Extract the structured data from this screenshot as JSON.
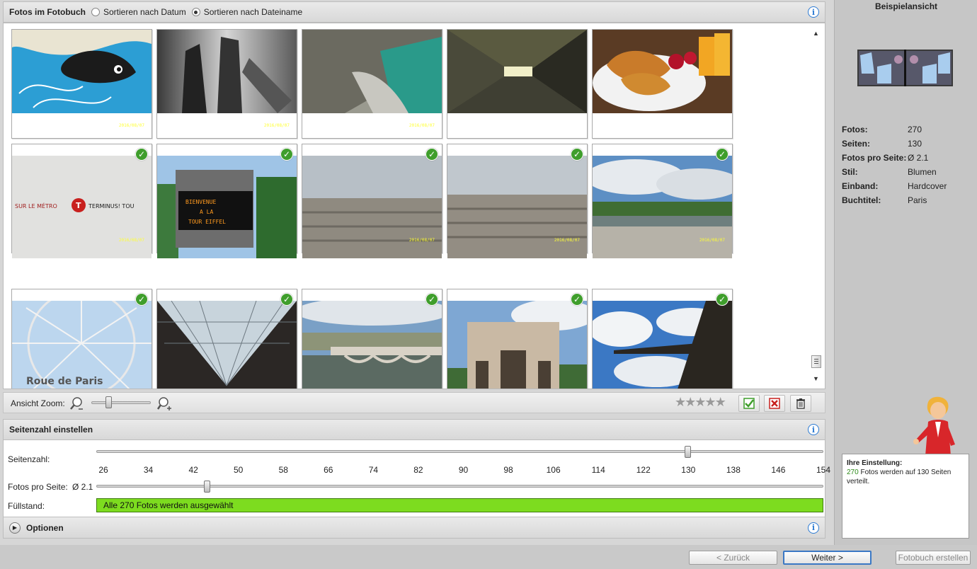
{
  "photos_header": {
    "title": "Fotos im Fotobuch",
    "sort_date": "Sortieren nach Datum",
    "sort_filename": "Sortieren nach Dateiname",
    "selected_sort": "filename"
  },
  "photos": [
    {
      "date": "2016/08/07",
      "checked": false
    },
    {
      "date": "2016/08/07",
      "checked": false
    },
    {
      "date": "2016/08/07",
      "checked": false
    },
    {
      "date": "",
      "checked": false
    },
    {
      "date": "",
      "checked": false
    },
    {
      "date": "2016/08/07",
      "checked": true
    },
    {
      "date": "",
      "checked": true
    },
    {
      "date": "2016/08/07",
      "checked": true
    },
    {
      "date": "2016/08/07",
      "checked": true
    },
    {
      "date": "2016/08/07",
      "checked": true
    },
    {
      "date": "",
      "checked": true
    },
    {
      "date": "",
      "checked": true
    },
    {
      "date": "",
      "checked": true
    },
    {
      "date": "",
      "checked": true
    },
    {
      "date": "",
      "checked": true
    }
  ],
  "zoom": {
    "label": "Ansicht Zoom:",
    "level": 0.3
  },
  "rating_stars": 5,
  "pages_panel": {
    "title": "Seitenzahl einstellen",
    "pages_label": "Seitenzahl:",
    "ticks": [
      "26",
      "34",
      "42",
      "50",
      "58",
      "66",
      "74",
      "82",
      "90",
      "98",
      "106",
      "114",
      "122",
      "130",
      "138",
      "146",
      "154"
    ],
    "pages_value": 130,
    "pages_min": 26,
    "pages_max": 154,
    "fotos_pro_seite_label": "Fotos pro Seite:",
    "fotos_pro_seite_value": "Ø 2.1",
    "fotos_pro_seite_level": 0.145,
    "fill_label": "Füllstand:",
    "fill_text": "Alle 270 Fotos werden ausgewählt",
    "fill_level": 1.0,
    "options_label": "Optionen"
  },
  "preview": {
    "title": "Beispielansicht"
  },
  "stats": [
    {
      "label": "Fotos:",
      "value": "270"
    },
    {
      "label": "Seiten:",
      "value": "130"
    },
    {
      "label": "Fotos pro Seite:",
      "value": "Ø 2.1"
    },
    {
      "label": "Stil:",
      "value": "Blumen"
    },
    {
      "label": "Einband:",
      "value": "Hardcover"
    },
    {
      "label": "Buchtitel:",
      "value": "Paris"
    }
  ],
  "hint": {
    "title": "Ihre Einstellung:",
    "count": "270",
    "text": "Fotos werden auf 130 Seiten verteilt."
  },
  "nav": {
    "back": "< Zurück",
    "next": "Weiter >",
    "create": "Fotobuch erstellen"
  },
  "colors": {
    "accent": "#2d7bd3",
    "check_green": "#3f9e2c",
    "fill_green": "#7ddc1f",
    "hint_green": "#2e8b1a"
  }
}
